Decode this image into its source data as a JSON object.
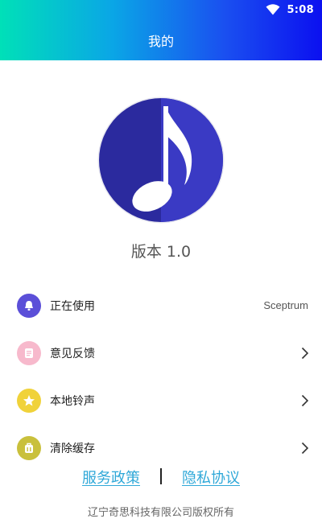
{
  "status_bar": {
    "time": "5:08"
  },
  "header": {
    "title": "我的"
  },
  "app": {
    "version": "版本 1.0"
  },
  "menu": {
    "items": [
      {
        "label": "正在使用",
        "value": "Sceptrum",
        "icon": "bell-icon",
        "icon_color": "#5b4fd8"
      },
      {
        "label": "意见反馈",
        "icon": "document-icon",
        "icon_color": "#f7b9cc"
      },
      {
        "label": "本地铃声",
        "icon": "star-icon",
        "icon_color": "#f0d23a"
      },
      {
        "label": "清除缓存",
        "icon": "backpack-icon",
        "icon_color": "#c9c03c"
      }
    ]
  },
  "footer": {
    "service_policy": "服务政策",
    "privacy_agreement": "隐私协议",
    "copyright": "辽宁奇思科技有限公司版权所有"
  },
  "colors": {
    "header_gradient_start": "#00e0b8",
    "header_gradient_end": "#0b10f0",
    "logo_blue": "#2f2fa8",
    "link_color": "#2fa8d8"
  }
}
